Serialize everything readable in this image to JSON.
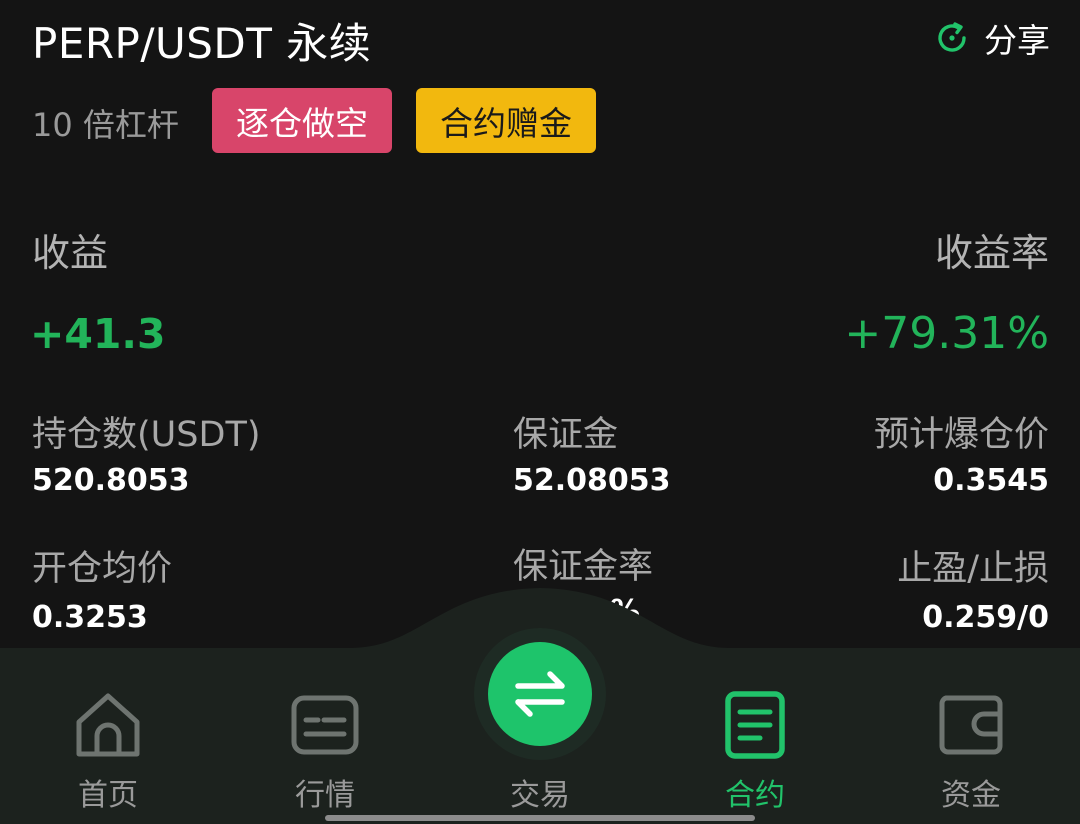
{
  "header": {
    "title": "PERP/USDT 永续",
    "share_label": "分享"
  },
  "position": {
    "leverage": "10 倍杠杆",
    "direction_badge": "逐仓做空",
    "bonus_badge": "合约赠金"
  },
  "pnl": {
    "label": "收益",
    "value": "+41.3",
    "rate_label": "收益率",
    "rate_value": "+79.31%"
  },
  "stats": {
    "size_label": "持仓数(USDT)",
    "size_value": "520.8053",
    "margin_label": "保证金",
    "margin_value": "52.08053",
    "liq_label": "预计爆仓价",
    "liq_value": "0.3545",
    "entry_label": "开仓均价",
    "entry_value": "0.3253",
    "margin_rate_label": "保证金率",
    "margin_rate_value_partial": "%",
    "tpsl_label": "止盈/止损",
    "tpsl_value": "0.259/0"
  },
  "nav": {
    "items": [
      {
        "label": "首页",
        "icon": "home-icon"
      },
      {
        "label": "行情",
        "icon": "market-icon"
      },
      {
        "label": "交易",
        "icon": "swap-icon"
      },
      {
        "label": "合约",
        "icon": "contract-icon"
      },
      {
        "label": "资金",
        "icon": "wallet-icon"
      }
    ],
    "active": "合约"
  },
  "colors": {
    "background": "#141414",
    "profit_green": "#22b45a",
    "accent_green": "#1ec46b",
    "short_badge": "#d8456a",
    "bonus_badge": "#f2b80e",
    "nav_background": "#1c221e"
  }
}
